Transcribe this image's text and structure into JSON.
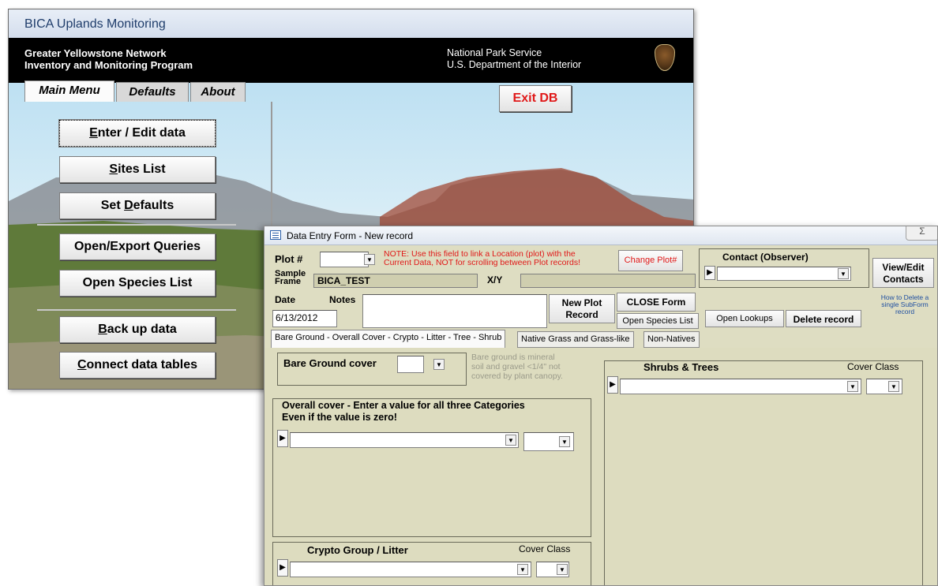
{
  "main_window": {
    "title": "BICA Uplands Monitoring",
    "banner_left": [
      "Greater Yellowstone Network",
      "Inventory and Monitoring Program"
    ],
    "banner_right": [
      "National Park Service",
      "U.S. Department of the Interior"
    ],
    "tabs": [
      "Main Menu",
      "Defaults",
      "About"
    ],
    "menu_buttons": [
      {
        "pre": "",
        "ul": "E",
        "post": "nter / Edit data"
      },
      {
        "pre": "",
        "ul": "S",
        "post": "ites List"
      },
      {
        "pre": "Set ",
        "ul": "D",
        "post": "efaults"
      },
      {
        "pre": "Open/Export Queries",
        "ul": "",
        "post": ""
      },
      {
        "pre": "Open Species List",
        "ul": "",
        "post": ""
      },
      {
        "pre": "",
        "ul": "B",
        "post": "ack up data"
      },
      {
        "pre": "",
        "ul": "C",
        "post": "onnect data tables"
      }
    ],
    "exit_label": "Exit DB"
  },
  "form": {
    "title": "Data Entry Form - New record",
    "close_glyph": "Σ",
    "plot_label": "Plot #",
    "plot_note": [
      "NOTE: Use this field to link a Location (plot) with the",
      "Current Data, NOT for scrolling between Plot records!"
    ],
    "change_plot": "Change Plot#",
    "sample_frame_label": [
      "Sample",
      "Frame"
    ],
    "sample_frame_value": "BICA_TEST",
    "xy_label": "X/Y",
    "date_label": "Date",
    "date_value": "6/13/2012",
    "notes_label": "Notes",
    "new_plot_record": [
      "New Plot",
      "Record"
    ],
    "close_form": "CLOSE Form",
    "open_species_list": "Open Species List",
    "contact_label": "Contact (Observer)",
    "view_edit_contacts": [
      "View/Edit",
      "Contacts"
    ],
    "delete_help": [
      "How to Delete a",
      "single SubForm",
      "record"
    ],
    "open_lookups": "Open Lookups",
    "delete_record": "Delete record",
    "tabs": [
      "Bare Ground - Overall Cover - Crypto - Litter - Tree - Shrub",
      "Native Grass and Grass-like",
      "Non-Natives"
    ],
    "bare_ground_label": "Bare Ground cover",
    "bare_ground_hint": [
      "Bare ground is mineral",
      "soil and gravel <1/4\" not",
      "covered by plant canopy."
    ],
    "overall_cover_label": [
      "Overall cover - Enter a value for all three Categories",
      "Even if the value is zero!"
    ],
    "crypto_label": "Crypto Group / Litter",
    "cover_class": "Cover Class",
    "shrubs_label": "Shrubs & Trees",
    "record_selector": "▶",
    "dropdown_glyph": "▼"
  },
  "colors": {
    "form_bg": "#deddc2",
    "exit_text": "#e01818",
    "note_text": "#e01818",
    "help_text": "#1f4fa0"
  }
}
